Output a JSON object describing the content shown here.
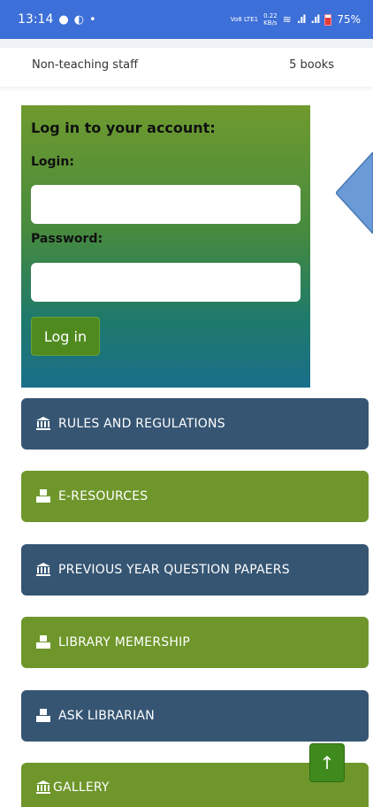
{
  "status_bar": {
    "time": "13:14",
    "volte": "Vo8 LTE1",
    "speed_value": "0.22",
    "speed_unit": "KB/s",
    "battery": "75%"
  },
  "staff_row": {
    "label": "Non-teaching staff",
    "count": "5 books"
  },
  "login": {
    "title": "Log in to your account:",
    "login_label": "Login:",
    "login_value": "",
    "password_label": "Password:",
    "password_value": "",
    "button_label": "Log in"
  },
  "menu": [
    {
      "label": "RULES AND REGULATIONS",
      "icon": "bank-icon",
      "color": "#355573"
    },
    {
      "label": "E-RESOURCES",
      "icon": "cubes-icon",
      "color": "#6e962b"
    },
    {
      "label": "PREVIOUS YEAR QUESTION PAPAERS",
      "icon": "bank-icon",
      "color": "#355573"
    },
    {
      "label": "LIBRARY MEMERSHIP",
      "icon": "cubes-icon",
      "color": "#6e962b"
    },
    {
      "label": "ASK LIBRARIAN",
      "icon": "cubes-icon",
      "color": "#355573"
    },
    {
      "label": "GALLERY",
      "icon": "bank-icon",
      "color": "#6e962b"
    }
  ],
  "scroll_top": {
    "icon": "arrow-up-icon"
  }
}
